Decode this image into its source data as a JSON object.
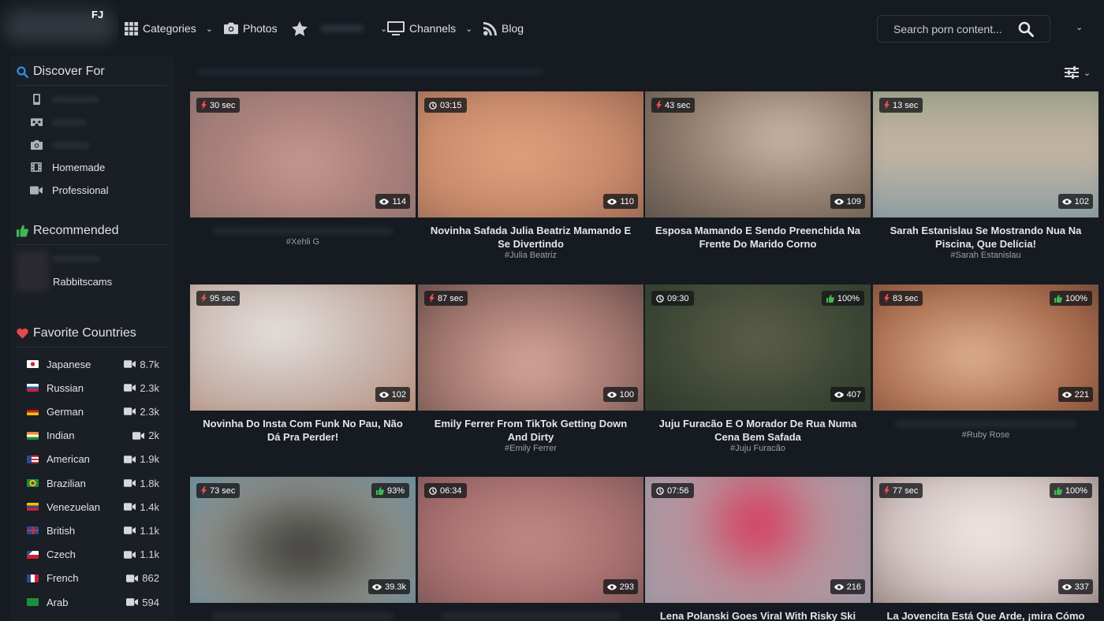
{
  "header": {
    "logo_text": "FJ",
    "nav": [
      {
        "label": "Categories",
        "icon": "grid-icon",
        "caret": "⌄"
      },
      {
        "label": "Photos",
        "icon": "camera-icon"
      },
      {
        "label": "",
        "icon": "star-icon",
        "caret": "⌄"
      },
      {
        "label": "Channels",
        "icon": "monitor-icon",
        "caret": "⌄"
      },
      {
        "label": "Blog",
        "icon": "rss-icon"
      }
    ],
    "search_placeholder": "Search porn content...",
    "user_caret": "⌄"
  },
  "sidebar": {
    "discover_title": "Discover For",
    "discover_items": [
      {
        "label": "",
        "icon": "phone-icon"
      },
      {
        "label": "",
        "icon": "vr-icon"
      },
      {
        "label": "",
        "icon": "camera-icon"
      },
      {
        "label": "Homemade",
        "icon": "film-icon"
      },
      {
        "label": "Professional",
        "icon": "video-camera-icon"
      }
    ],
    "recommended_title": "Recommended",
    "recommended_name": "Rabbitscams",
    "countries_title": "Favorite Countries",
    "countries": [
      {
        "name": "Japanese",
        "count": "8.7k",
        "flag": "jp"
      },
      {
        "name": "Russian",
        "count": "2.3k",
        "flag": "ru"
      },
      {
        "name": "German",
        "count": "2.3k",
        "flag": "de"
      },
      {
        "name": "Indian",
        "count": "2k",
        "flag": "in"
      },
      {
        "name": "American",
        "count": "1.9k",
        "flag": "us"
      },
      {
        "name": "Brazilian",
        "count": "1.8k",
        "flag": "br"
      },
      {
        "name": "Venezuelan",
        "count": "1.4k",
        "flag": "ve"
      },
      {
        "name": "British",
        "count": "1.1k",
        "flag": "gb"
      },
      {
        "name": "Czech",
        "count": "1.1k",
        "flag": "cz"
      },
      {
        "name": "French",
        "count": "862",
        "flag": "fr"
      },
      {
        "name": "Arab",
        "count": "594",
        "flag": "sa"
      }
    ]
  },
  "videos": [
    {
      "duration": "30 sec",
      "duration_type": "flash",
      "rating": "",
      "views": "114",
      "title": "",
      "tag": "#Xehli G"
    },
    {
      "duration": "03:15",
      "duration_type": "clock",
      "rating": "",
      "views": "110",
      "title": "Novinha Safada Julia Beatriz Mamando E Se Divertindo",
      "tag": "#Julia Beatriz"
    },
    {
      "duration": "43 sec",
      "duration_type": "flash",
      "rating": "",
      "views": "109",
      "title": "Esposa Mamando E Sendo Preenchida Na Frente Do Marido Corno",
      "tag": ""
    },
    {
      "duration": "13 sec",
      "duration_type": "flash",
      "rating": "",
      "views": "102",
      "title": "Sarah Estanislau Se Mostrando Nua Na Piscina, Que Delícia!",
      "tag": "#Sarah Estanislau"
    },
    {
      "duration": "95 sec",
      "duration_type": "flash",
      "rating": "",
      "views": "102",
      "title": "Novinha Do Insta Com Funk No Pau, Não Dá Pra Perder!",
      "tag": ""
    },
    {
      "duration": "87 sec",
      "duration_type": "flash",
      "rating": "",
      "views": "100",
      "title": "Emily Ferrer From TikTok Getting Down And Dirty",
      "tag": "#Emily Ferrer"
    },
    {
      "duration": "09:30",
      "duration_type": "clock",
      "rating": "100%",
      "views": "407",
      "title": "Juju Furacão E O Morador De Rua Numa Cena Bem Safada",
      "tag": "#Juju Furacão"
    },
    {
      "duration": "83 sec",
      "duration_type": "flash",
      "rating": "100%",
      "views": "221",
      "title": "",
      "tag": "#Ruby Rose"
    },
    {
      "duration": "73 sec",
      "duration_type": "flash",
      "rating": "93%",
      "views": "39.3k",
      "title": "",
      "tag": ""
    },
    {
      "duration": "06:34",
      "duration_type": "clock",
      "rating": "",
      "views": "293",
      "title": "",
      "tag": ""
    },
    {
      "duration": "07:56",
      "duration_type": "clock",
      "rating": "",
      "views": "216",
      "title": "Lena Polanski Goes Viral With Risky Ski Lift",
      "tag": ""
    },
    {
      "duration": "77 sec",
      "duration_type": "flash",
      "rating": "100%",
      "views": "337",
      "title": "La Jovencita Está Que Arde, ¡mira Cómo Se",
      "tag": ""
    }
  ],
  "colors": {
    "accent_blue": "#2f8ee8",
    "accent_green": "#3fb950",
    "accent_red": "#e5484d",
    "flash_red": "#ff4d4d",
    "bg": "#161a21",
    "sidebar_bg": "#1a1e25"
  }
}
